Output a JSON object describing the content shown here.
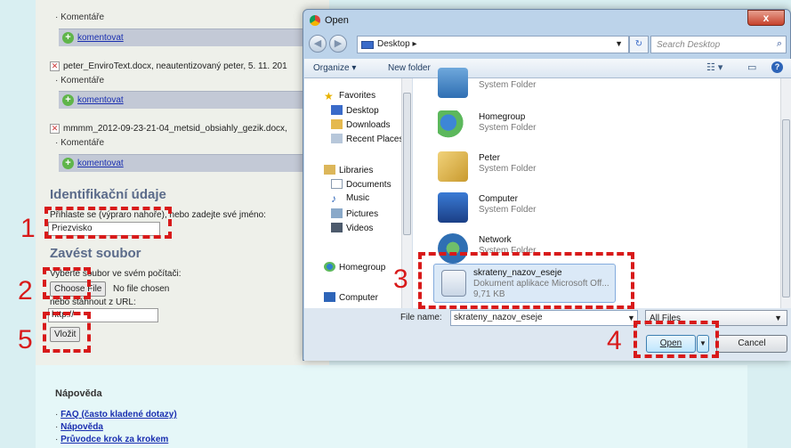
{
  "page": {
    "comments_label": "Komentáře",
    "comment_link": "komentovat",
    "files": [
      "peter_EnviroText.docx, neautentizovaný peter, 5. 11. 201",
      "mmmm_2012-09-23-21-04_metsid_obsiahly_gezik.docx,"
    ],
    "ident_title": "Identifikační údaje",
    "ident_text": "Přihlaste se (výpraro nahoře), nebo zadejte své jméno:",
    "name_value": "Priezvisko",
    "attach_title": "Zavést soubor",
    "attach_text": "Vyberte soubor ve svém počítači:",
    "choose_file": "Choose File",
    "no_file": "No file chosen",
    "or_url": "nebo stáhnout z URL:",
    "url_value": "http://",
    "insert_button": "Vložit",
    "help_title": "Nápověda",
    "help_links": [
      "FAQ (často kladené dotazy)",
      "Nápověda",
      "Průvodce krok za krokem"
    ]
  },
  "annotations": [
    "1",
    "2",
    "3",
    "4",
    "5"
  ],
  "dialog": {
    "title": "Open",
    "close": "x",
    "address": "Desktop",
    "address_arrow": "▸",
    "search_placeholder": "Search Desktop",
    "toolbar": {
      "organize": "Organize ▾",
      "new_folder": "New folder"
    },
    "nav": {
      "favorites": "Favorites",
      "desktop": "Desktop",
      "downloads": "Downloads",
      "recent": "Recent Places",
      "libraries": "Libraries",
      "documents": "Documents",
      "music": "Music",
      "pictures": "Pictures",
      "videos": "Videos",
      "homegroup": "Homegroup",
      "computer": "Computer"
    },
    "items": [
      {
        "name": "",
        "type": "System Folder"
      },
      {
        "name": "Homegroup",
        "type": "System Folder"
      },
      {
        "name": "Peter",
        "type": "System Folder"
      },
      {
        "name": "Computer",
        "type": "System Folder"
      },
      {
        "name": "Network",
        "type": "System Folder"
      },
      {
        "name": "skrateny_nazov_eseje",
        "type": "Dokument aplikace Microsoft Off...",
        "size": "9,71 KB"
      }
    ],
    "file_name_label": "File name:",
    "file_name_value": "skrateny_nazov_eseje",
    "file_type": "All Files",
    "open_button": "Open",
    "cancel_button": "Cancel"
  },
  "colors": {
    "annotation": "#d81a1a",
    "link": "#1a2fb0",
    "dialog_frame": "#bcd3ea"
  }
}
